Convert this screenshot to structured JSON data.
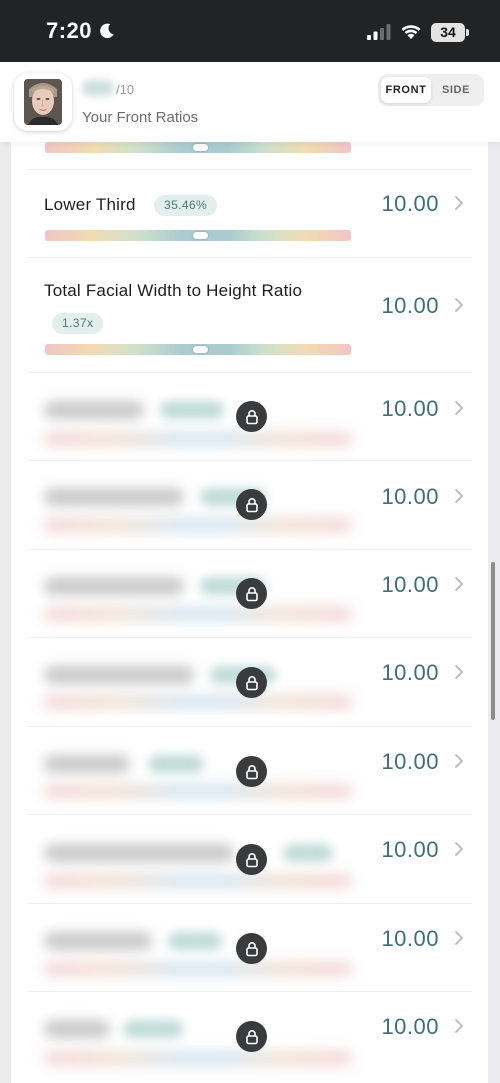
{
  "status_bar": {
    "time": "7:20",
    "battery": "34"
  },
  "header": {
    "score_suffix": "/10",
    "subtitle": "Your Front Ratios",
    "toggle": {
      "front": "FRONT",
      "side": "SIDE",
      "active": "FRONT"
    }
  },
  "ratios": [
    {
      "title": "Lower Third",
      "value": "35.46%",
      "score": "10.00",
      "position": 0.5
    },
    {
      "title": "Total Facial Width to Height Ratio",
      "value": "1.37x",
      "score": "10.00",
      "position": 0.5
    }
  ],
  "locked_rows": [
    {
      "score": "10.00"
    },
    {
      "score": "10.00"
    },
    {
      "score": "10.00"
    },
    {
      "score": "10.00"
    },
    {
      "score": "10.00"
    },
    {
      "score": "10.00"
    },
    {
      "score": "10.00"
    },
    {
      "score": "10.00"
    }
  ],
  "colors": {
    "score": "#3e6f78",
    "pill_bg": "#e3efec",
    "pill_text": "#4e7a73",
    "status_bar_bg": "#222325"
  }
}
